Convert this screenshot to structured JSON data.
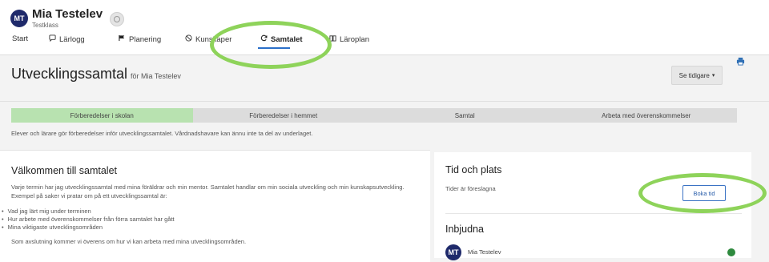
{
  "user": {
    "initials": "MT",
    "name": "Mia Testelev",
    "class": "Testklass"
  },
  "nav": {
    "items": [
      {
        "label": "Start",
        "icon": ""
      },
      {
        "label": "Lärlogg",
        "icon": "speech-bubble-icon"
      },
      {
        "label": "Planering",
        "icon": "flag-icon"
      },
      {
        "label": "Kunskaper",
        "icon": "target-icon"
      },
      {
        "label": "Samtalet",
        "icon": "refresh-icon"
      },
      {
        "label": "Läroplan",
        "icon": "book-icon"
      }
    ],
    "active_index": 4
  },
  "page": {
    "title": "Utvecklingssamtal",
    "for_text": "för Mia Testelev",
    "earlier_button": "Se tidigare"
  },
  "steps": {
    "items": [
      "Förberedelser i skolan",
      "Förberedelser i hemmet",
      "Samtal",
      "Arbeta med överenskommelser"
    ],
    "active_index": 0,
    "note": "Elever och lärare gör förberedelser inför utvecklingssamtalet. Vårdnadshavare kan ännu inte ta del av underlaget."
  },
  "welcome": {
    "title": "Välkommen till samtalet",
    "text": "Varje termin har jag utvecklingssamtal med mina föräldrar och min mentor. Samtalet handlar om min sociala utveckling och min kunskapsutveckling. Exempel på saker vi pratar om på ett utvecklingssamtal är:",
    "bullets": [
      "Vad jag lärt mig under terminen",
      "Hur arbete med överenskommelser från förra samtalet har gått",
      "Mina viktigaste utvecklingsområden"
    ],
    "closing": "Som avslutning kommer vi överens om hur vi kan arbeta med mina utvecklingsområden."
  },
  "time_place": {
    "title": "Tid och plats",
    "status": "Tider är föreslagna",
    "book_button": "Boka tid"
  },
  "invited": {
    "title": "Inbjudna",
    "people": [
      {
        "initials": "MT",
        "name": "Mia Testelev",
        "status_color": "#2e8a3e"
      }
    ]
  },
  "colors": {
    "accent": "#2a6fc9",
    "avatar": "#1f2a6b",
    "active_step": "#b8e2b0",
    "highlight": "#8ed35a"
  }
}
